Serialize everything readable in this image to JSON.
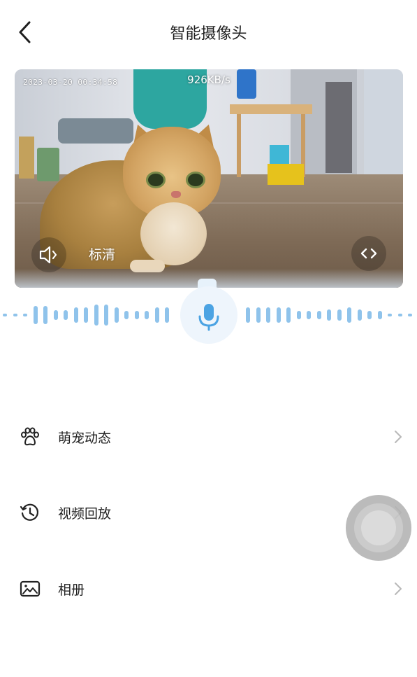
{
  "header": {
    "title": "智能摄像头",
    "back_icon": "chevron-left-icon"
  },
  "video": {
    "timestamp": "2023-03-20  00:34:58",
    "bitrate": "926KB/s",
    "quality_label": "标清",
    "sound_icon": "speaker-icon",
    "expand_icon": "code-arrows-icon"
  },
  "voice": {
    "mic_icon": "microphone-icon"
  },
  "menu": {
    "items": [
      {
        "label": "萌宠动态",
        "icon": "paw-icon"
      },
      {
        "label": "视频回放",
        "icon": "history-clock-icon"
      },
      {
        "label": "相册",
        "icon": "image-icon"
      }
    ],
    "arrow_icon": "chevron-right-icon"
  },
  "colors": {
    "accent": "#4ba3e3",
    "wave": "#8fc3eb",
    "text": "#222222",
    "arrow": "#b8b8b8"
  }
}
